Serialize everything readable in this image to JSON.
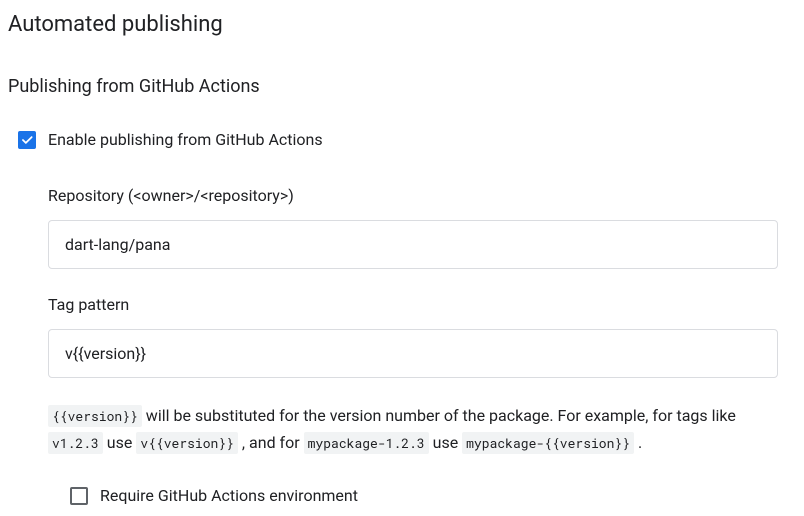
{
  "page_title": "Automated publishing",
  "section_title": "Publishing from GitHub Actions",
  "enable_checkbox": {
    "label": "Enable publishing from GitHub Actions",
    "checked": true
  },
  "repository": {
    "label": "Repository (<owner>/<repository>)",
    "value": "dart-lang/pana"
  },
  "tag_pattern": {
    "label": "Tag pattern",
    "value": "v{{version}}"
  },
  "help": {
    "code1": "{{version}}",
    "text1": " will be substituted for the version number of the package. For example, for tags like ",
    "code2": "v1.2.3",
    "text2": " use ",
    "code3": "v{{version}}",
    "text3": " , and for ",
    "code4": "mypackage-1.2.3",
    "text4": " use ",
    "code5": "mypackage-{{version}}",
    "text5": " ."
  },
  "require_env": {
    "label": "Require GitHub Actions environment",
    "checked": false
  }
}
